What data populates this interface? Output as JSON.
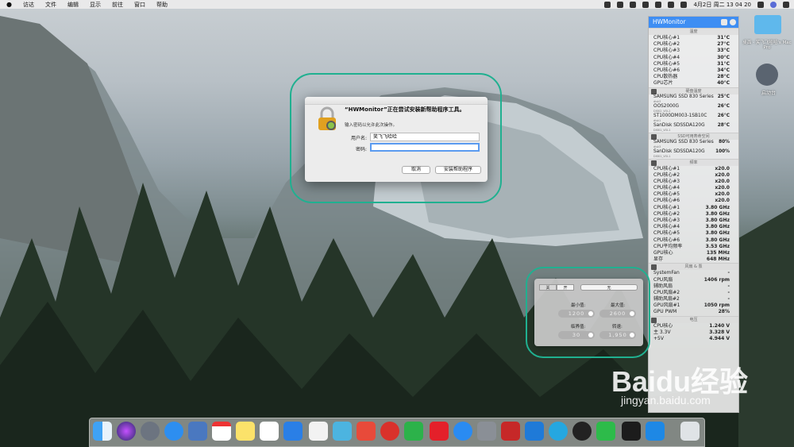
{
  "menubar": {
    "apple": "",
    "items": [
      "访达",
      "文件",
      "编辑",
      "显示",
      "前往",
      "窗口",
      "帮助"
    ],
    "datetime": "4月2日 周二 13 04 20"
  },
  "dialog": {
    "title": "“HWMonitor”正在尝试安装新帮助程序工具。",
    "subtitle": "输入密码以允许此次操作。",
    "username_label": "用户名:",
    "username_value": "笑飞飞哈哈",
    "password_label": "密码:",
    "password_value": "",
    "cancel": "取消",
    "install": "安装帮助程序"
  },
  "hw": {
    "title": "HWMonitor",
    "sec_temp": "温度",
    "temps": [
      [
        "CPU核心#1",
        "31°C"
      ],
      [
        "CPU核心#2",
        "27°C"
      ],
      [
        "CPU核心#3",
        "33°C"
      ],
      [
        "CPU核心#4",
        "30°C"
      ],
      [
        "CPU核心#5",
        "31°C"
      ],
      [
        "CPU核心#6",
        "34°C"
      ],
      [
        "CPU散热器",
        "28°C"
      ],
      [
        "GPU芯片",
        "40°C"
      ]
    ],
    "sec_disk": "硬盘温度",
    "disks": [
      {
        "name": "SAMSUNG SSD 830 Series",
        "sub": "disk3",
        "v": "25°C"
      },
      {
        "name": "OOS2000G",
        "sub": "DISK2_VOL2",
        "v": "26°C"
      },
      {
        "name": "ST1000DM003-1SB10C",
        "sub": "disk1",
        "v": "26°C"
      },
      {
        "name": "SanDisk SDSSDA120G",
        "sub": "DISK1_VOL1",
        "v": "28°C"
      }
    ],
    "sec_ssd": "SSD可用寿命空间",
    "ssd": [
      {
        "name": "SAMSUNG SSD 830 Series",
        "sub": "disk3",
        "v": "80%"
      },
      {
        "name": "SanDisk SDSSDA120G",
        "sub": "DISK1_VOL1",
        "v": "100%"
      }
    ],
    "sec_freq": "频率",
    "mult": [
      [
        "CPU核心#1",
        "x20.0"
      ],
      [
        "CPU核心#2",
        "x20.0"
      ],
      [
        "CPU核心#3",
        "x20.0"
      ],
      [
        "CPU核心#4",
        "x20.0"
      ],
      [
        "CPU核心#5",
        "x20.0"
      ],
      [
        "CPU核心#6",
        "x20.0"
      ]
    ],
    "freq": [
      [
        "CPU核心#1",
        "3.80 GHz"
      ],
      [
        "CPU核心#2",
        "3.80 GHz"
      ],
      [
        "CPU核心#3",
        "3.80 GHz"
      ],
      [
        "CPU核心#4",
        "3.80 GHz"
      ],
      [
        "CPU核心#5",
        "3.80 GHz"
      ],
      [
        "CPU核心#6",
        "3.80 GHz"
      ],
      [
        "CPU平均频率",
        "3.53 GHz"
      ],
      [
        "GPU核心",
        "135 MHz"
      ],
      [
        "显存",
        "648 MHz"
      ]
    ],
    "sec_fan": "风扇 & 泵",
    "fans": [
      [
        "SystemFan",
        "-"
      ],
      [
        "CPU风扇",
        "1406 rpm"
      ],
      [
        "辅助风扇",
        "-"
      ],
      [
        "CPU风扇#2",
        "-"
      ],
      [
        "辅助风扇#2",
        "-"
      ],
      [
        "GPU风扇#1",
        "1050 rpm"
      ],
      [
        "GPU PWM",
        "28%"
      ]
    ],
    "sec_volt": "电压",
    "volts": [
      [
        "CPU核心",
        "1.240 V"
      ],
      [
        "主 3.3V",
        "3.328 V"
      ],
      [
        "+5V",
        "4.944 V"
      ]
    ]
  },
  "fan": {
    "seg_off": "关",
    "seg_on": "开",
    "seg_select": "无",
    "min_label": "最小值:",
    "max_label": "最大值:",
    "min_value": "1200",
    "max_value": "2600",
    "thr_label": "临界值:",
    "speed_label": "转速:",
    "thr_value": "30",
    "speed_value": "1,950"
  },
  "desktop": {
    "folder_label": "桌面 - 笑飞飞哈哈's Mac Pro",
    "launch_label": "启动台"
  },
  "watermark": {
    "brand": "Baidu经验",
    "url": "jingyan.baidu.com"
  },
  "colors": {
    "accent": "#3e8ef3",
    "highlight": "#20b090"
  }
}
